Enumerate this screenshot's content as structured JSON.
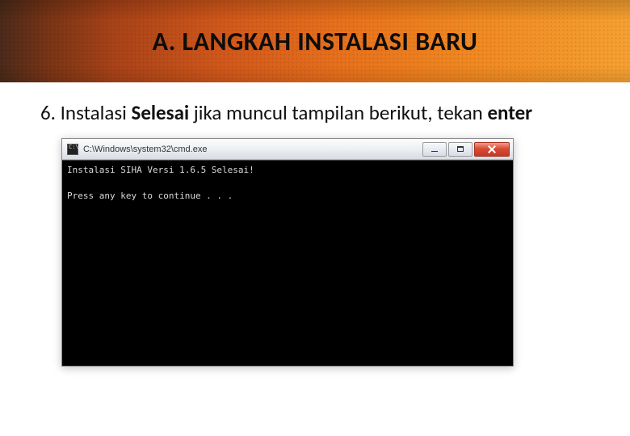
{
  "header": {
    "title": "A. LANGKAH INSTALASI BARU"
  },
  "step": {
    "prefix": "6. Instalasi ",
    "bold1": "Selesai",
    "middle": " jika muncul tampilan berikut, tekan ",
    "bold2": "enter"
  },
  "cmd": {
    "path": "C:\\Windows\\system32\\cmd.exe",
    "line1": "Instalasi SIHA Versi 1.6.5 Selesai!",
    "line2": "Press any key to continue . . ."
  }
}
